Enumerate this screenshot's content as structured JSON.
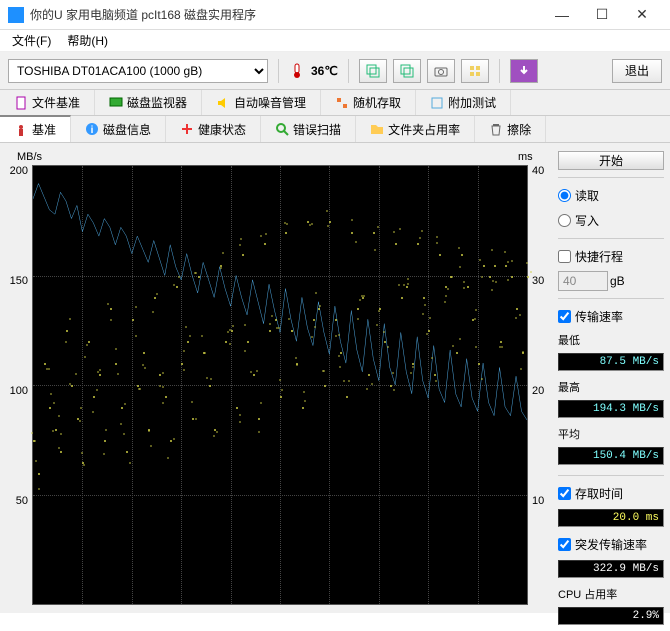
{
  "window": {
    "title": "你的U 家用电脑频道 pcIt168 磁盘实用程序"
  },
  "menu": {
    "file": "文件(F)",
    "help": "帮助(H)"
  },
  "toolbar": {
    "disk": "TOSHIBA DT01ACA100 (1000 gB)",
    "temp": "36℃",
    "exit": "退出"
  },
  "tabs_top": [
    "文件基准",
    "磁盘监视器",
    "自动噪音管理",
    "随机存取",
    "附加测试"
  ],
  "tabs_bottom": [
    "基准",
    "磁盘信息",
    "健康状态",
    "错误扫描",
    "文件夹占用率",
    "擦除"
  ],
  "side": {
    "start": "开始",
    "read": "读取",
    "write": "写入",
    "short": "快捷行程",
    "short_val": "40",
    "short_unit": "gB",
    "xfer_label": "传输速率",
    "min_label": "最低",
    "min_val": "87.5 MB/s",
    "max_label": "最高",
    "max_val": "194.3 MB/s",
    "avg_label": "平均",
    "avg_val": "150.4 MB/s",
    "access_label": "存取时间",
    "access_val": "20.0 ms",
    "burst_label": "突发传输速率",
    "burst_val": "322.9 MB/s",
    "cpu_label": "CPU 占用率",
    "cpu_val": "2.9%"
  },
  "chart_data": {
    "type": "line",
    "y_left_label": "MB/s",
    "y_left_min": 0,
    "y_left_max": 200,
    "y_left_step": 50,
    "y_right_label": "ms",
    "y_right_min": 0,
    "y_right_max": 40,
    "y_right_step": 10,
    "y_left_ticks": [
      "200",
      "150",
      "100",
      "50"
    ],
    "y_right_ticks": [
      "40",
      "30",
      "20",
      "10"
    ],
    "series": [
      {
        "name": "transfer_rate_MBps",
        "axis": "left",
        "color": "#4fa8e0",
        "values": [
          185,
          192,
          186,
          180,
          178,
          188,
          184,
          176,
          182,
          170,
          178,
          174,
          168,
          176,
          172,
          164,
          172,
          168,
          160,
          168,
          162,
          156,
          166,
          158,
          150,
          164,
          154,
          148,
          160,
          150,
          142,
          156,
          148,
          140,
          154,
          144,
          136,
          150,
          140,
          132,
          148,
          138,
          128,
          146,
          134,
          124,
          144,
          130,
          120,
          140,
          126,
          118,
          138,
          124,
          114,
          136,
          120,
          110,
          134,
          116,
          106,
          130,
          112,
          102,
          128,
          108,
          100,
          124,
          106,
          96,
          122,
          102,
          94,
          118,
          98,
          92,
          116,
          96,
          90,
          112,
          94,
          88,
          110,
          92,
          86,
          108,
          90,
          86,
          104,
          88,
          84
        ]
      },
      {
        "name": "access_time_ms",
        "axis": "right",
        "color": "#cccc44",
        "type": "scatter",
        "values": [
          15,
          12,
          22,
          18,
          16,
          14,
          25,
          20,
          17,
          13,
          24,
          19,
          21,
          15,
          27,
          22,
          18,
          14,
          26,
          20,
          23,
          16,
          28,
          21,
          19,
          15,
          29,
          22,
          24,
          17,
          30,
          23,
          20,
          16,
          31,
          24,
          25,
          18,
          32,
          24,
          21,
          17,
          33,
          25,
          26,
          19,
          34,
          25,
          22,
          18,
          35,
          26,
          27,
          20,
          35,
          26,
          23,
          19,
          34,
          27,
          28,
          21,
          34,
          27,
          24,
          20,
          33,
          28,
          29,
          22,
          33,
          28,
          25,
          21,
          32,
          29,
          30,
          23,
          32,
          29,
          26,
          22,
          31,
          30,
          31,
          24,
          31,
          30,
          27,
          23,
          30
        ]
      }
    ]
  }
}
